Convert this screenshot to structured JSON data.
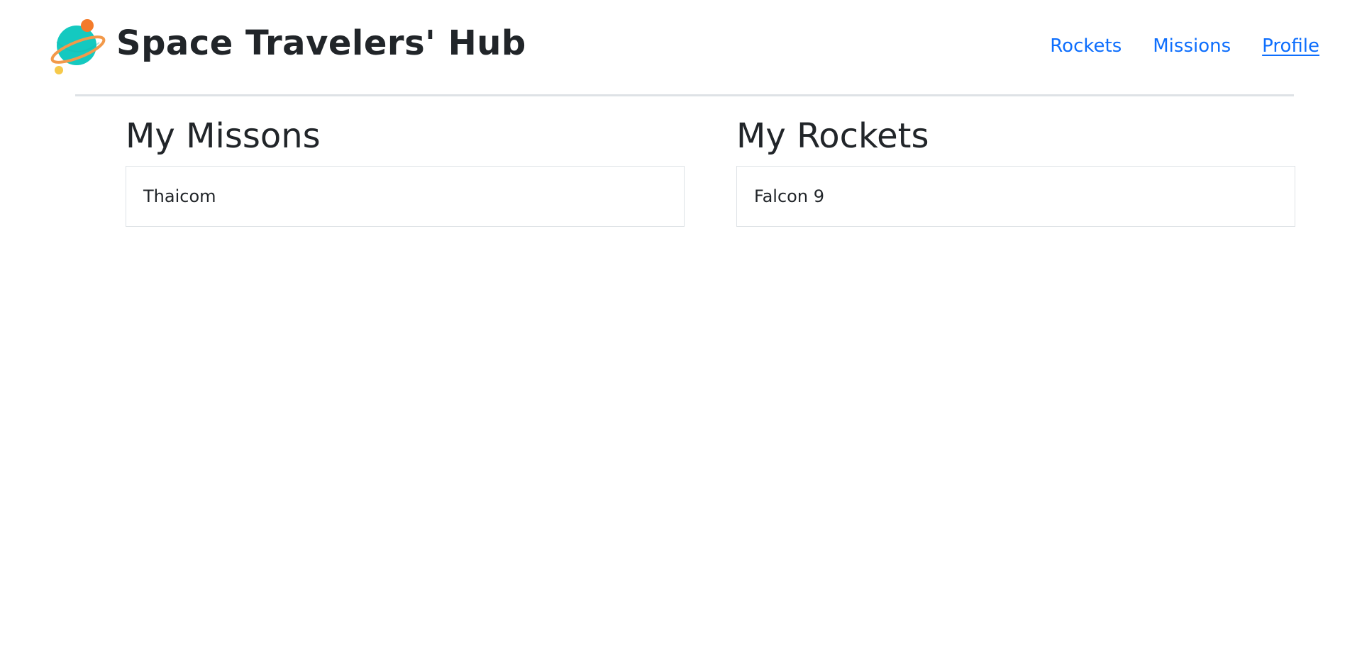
{
  "header": {
    "title": "Space Travelers' Hub",
    "logo_icon": "planet-icon",
    "nav": [
      {
        "label": "Rockets",
        "active": false
      },
      {
        "label": "Missions",
        "active": false
      },
      {
        "label": "Profile",
        "active": true
      }
    ]
  },
  "missions_section": {
    "title": "My Missons",
    "items": [
      "Thaicom"
    ]
  },
  "rockets_section": {
    "title": "My Rockets",
    "items": [
      "Falcon 9"
    ]
  },
  "colors": {
    "link": "#0d6efd",
    "text": "#212529",
    "border": "#dee2e6",
    "planet": "#14c9c0",
    "ring": "#f2994a",
    "moon_small": "#f6c94a"
  }
}
